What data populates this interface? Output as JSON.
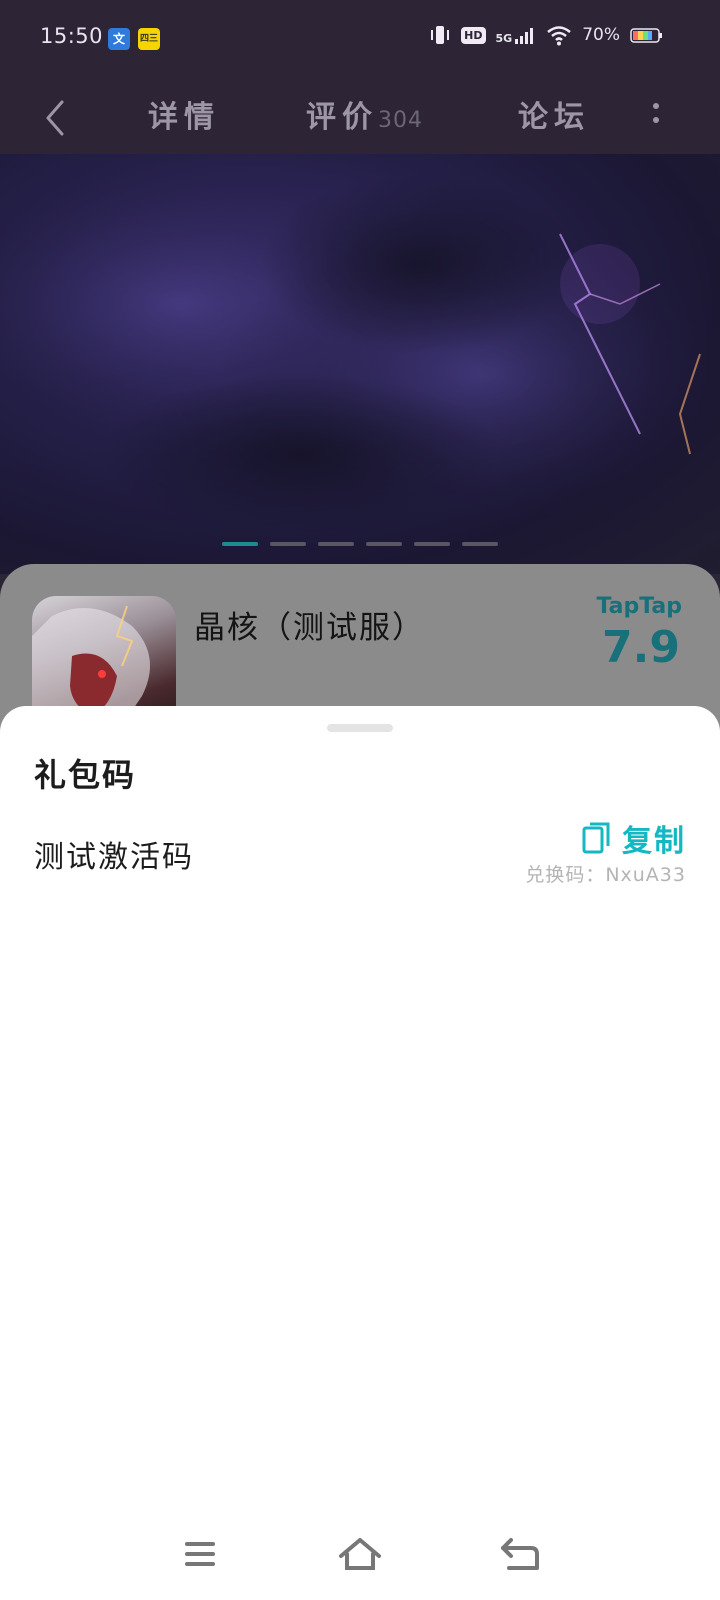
{
  "status_bar": {
    "time": "15:50",
    "left_icons": [
      {
        "name": "translate-app-icon",
        "glyph": "文",
        "color": "#2f7bdc"
      },
      {
        "name": "notification-app-icon",
        "glyph": "四三",
        "color": "#f5d400"
      }
    ],
    "hd_label": "HD",
    "network_label": "5G",
    "battery": "70%"
  },
  "top_nav": {
    "tab_details": "详情",
    "tab_reviews": "评价",
    "reviews_count": "304",
    "tab_forum": "论坛"
  },
  "carousel": {
    "slide_count": 6,
    "active_index": 0,
    "accent_color": "#1e8c8f"
  },
  "app_info": {
    "title": "晶核（测试服）",
    "rating_brand": "TapTap",
    "rating_score": "7.9",
    "rating_color": "#17707a"
  },
  "gift_sheet": {
    "title": "礼包码",
    "gift_name": "测试激活码",
    "copy_label": "复制",
    "redeem_code_text": "兑换码：NxuA33",
    "accent_color": "#15b8c2"
  },
  "nav_bar": {
    "buttons": [
      "menu-icon",
      "home-icon",
      "back-icon"
    ]
  }
}
